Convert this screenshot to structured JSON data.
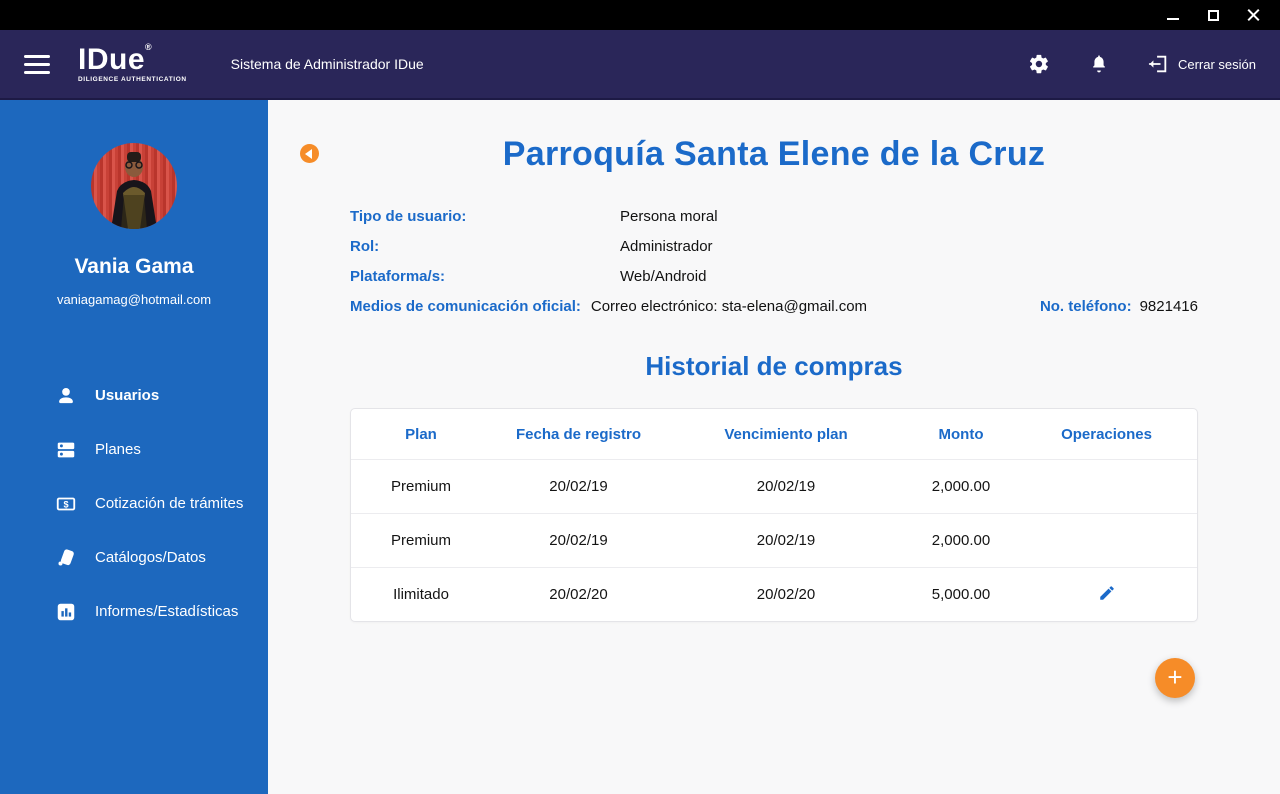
{
  "window": {
    "controls": {
      "minimize": "minimize",
      "maximize": "maximize",
      "close": "close"
    }
  },
  "header": {
    "logo_text": "IDue",
    "logo_registered": "®",
    "logo_subtext": "DILIGENCE AUTHENTICATION",
    "subtitle": "Sistema de Administrador IDue",
    "logout_label": "Cerrar sesión"
  },
  "sidebar": {
    "user": {
      "name": "Vania Gama",
      "email": "vaniagamag@hotmail.com"
    },
    "items": [
      {
        "label": "Usuarios",
        "icon": "user-icon",
        "active": true
      },
      {
        "label": "Planes",
        "icon": "plans-icon",
        "active": false
      },
      {
        "label": "Cotización de trámites",
        "icon": "quote-money-icon",
        "active": false
      },
      {
        "label": "Catálogos/Datos",
        "icon": "catalog-icon",
        "active": false
      },
      {
        "label": "Informes/Estadísticas",
        "icon": "stats-icon",
        "active": false
      }
    ]
  },
  "main": {
    "page_title": "Parroquía Santa Elene de la Cruz",
    "fields": [
      {
        "label": "Tipo de usuario:",
        "value": "Persona moral"
      },
      {
        "label": "Rol:",
        "value": "Administrador"
      },
      {
        "label": "Plataforma/s:",
        "value": "Web/Android"
      },
      {
        "label": "Medios de comunicación oficial:",
        "value": "Correo electrónico: sta-elena@gmail.com"
      }
    ],
    "phone": {
      "label": "No. teléfono:",
      "value": "9821416"
    },
    "section_title": "Historial de compras",
    "table": {
      "headers": [
        "Plan",
        "Fecha de registro",
        "Vencimiento plan",
        "Monto",
        "Operaciones"
      ],
      "rows": [
        {
          "plan": "Premium",
          "fecha_registro": "20/02/19",
          "vencimiento": "20/02/19",
          "monto": "2,000.00",
          "has_edit": false
        },
        {
          "plan": "Premium",
          "fecha_registro": "20/02/19",
          "vencimiento": "20/02/19",
          "monto": "2,000.00",
          "has_edit": false
        },
        {
          "plan": "Ilimitado",
          "fecha_registro": "20/02/20",
          "vencimiento": "20/02/20",
          "monto": "5,000.00",
          "has_edit": true
        }
      ]
    },
    "fab_label": "+"
  },
  "colors": {
    "titlebar_bg": "#000000",
    "header_bg": "#2A2659",
    "sidebar_bg": "#1D68BE",
    "accent_blue": "#1B6AC9",
    "accent_orange": "#F68C28",
    "content_bg": "#F8F8F9"
  }
}
